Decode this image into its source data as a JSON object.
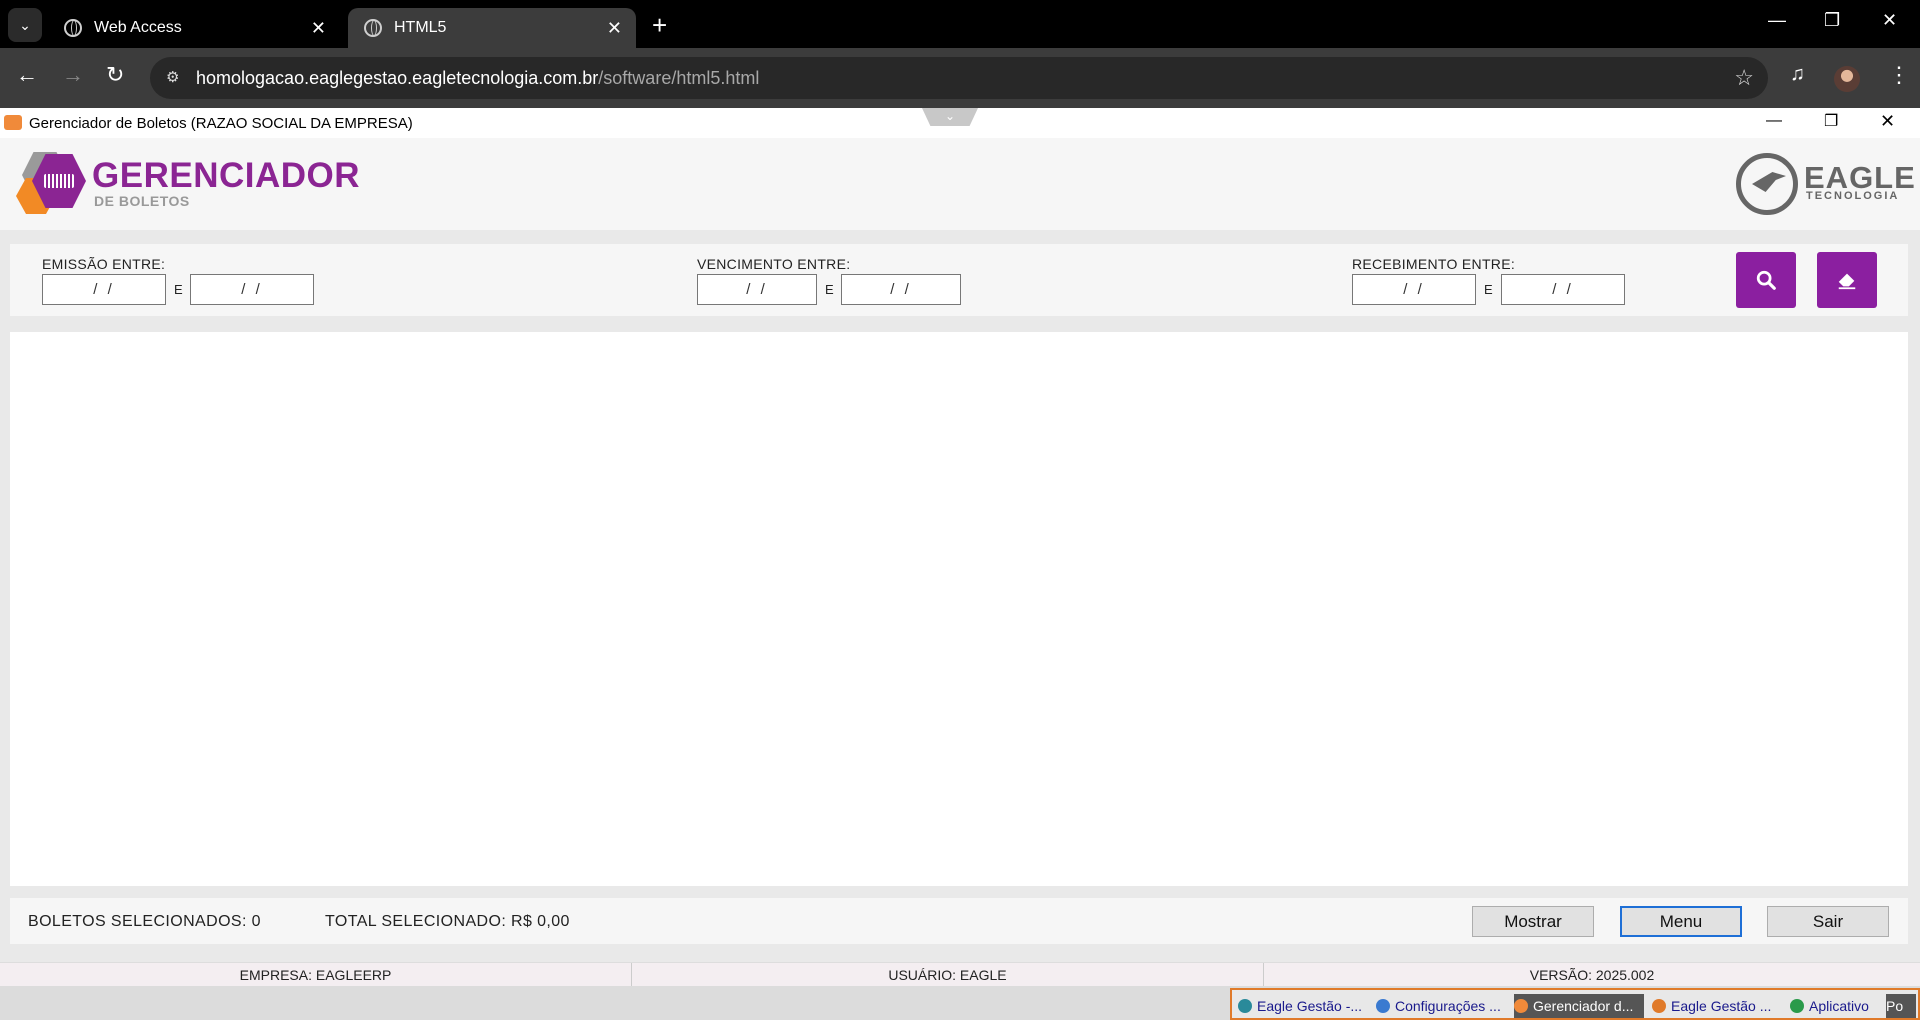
{
  "browser": {
    "tabs": [
      {
        "title": "Web Access",
        "active": false
      },
      {
        "title": "HTML5",
        "active": true
      }
    ],
    "url_host": "homologacao.eaglegestao.eagletecnologia.com.br",
    "url_path": "/software/html5.html"
  },
  "app": {
    "window_title": "Gerenciador de Boletos (RAZAO SOCIAL DA EMPRESA)",
    "logo_title": "GERENCIADOR",
    "logo_subtitle": "DE BOLETOS",
    "brand_word": "EAGLE",
    "brand_sub": "TECNOLOGIA"
  },
  "filters": {
    "emissao_label": "EMISSÃO ENTRE:",
    "vencimento_label": "VENCIMENTO ENTRE:",
    "recebimento_label": "RECEBIMENTO ENTRE:",
    "between": "E",
    "date_empty": " / / ",
    "search_icon": "search-icon",
    "clear_icon": "eraser-icon",
    "accent_color": "#8b1fa0"
  },
  "footer": {
    "selected_count_label": "BOLETOS SELECIONADOS: 0",
    "selected_total_label": "TOTAL SELECIONADO: R$ 0,00",
    "buttons": {
      "show": "Mostrar",
      "menu": "Menu",
      "exit": "Sair"
    }
  },
  "status": {
    "empresa": "EMPRESA: EAGLEERP",
    "usuario": "USUÁRIO: EAGLE",
    "versao": "VERSÃO: 2025.002"
  },
  "taskbar": {
    "items": [
      "Eagle Gestão -...",
      "Configurações ...",
      "Gerenciador d...",
      "Eagle Gestão ...",
      "Aplicativo",
      "Po"
    ]
  }
}
